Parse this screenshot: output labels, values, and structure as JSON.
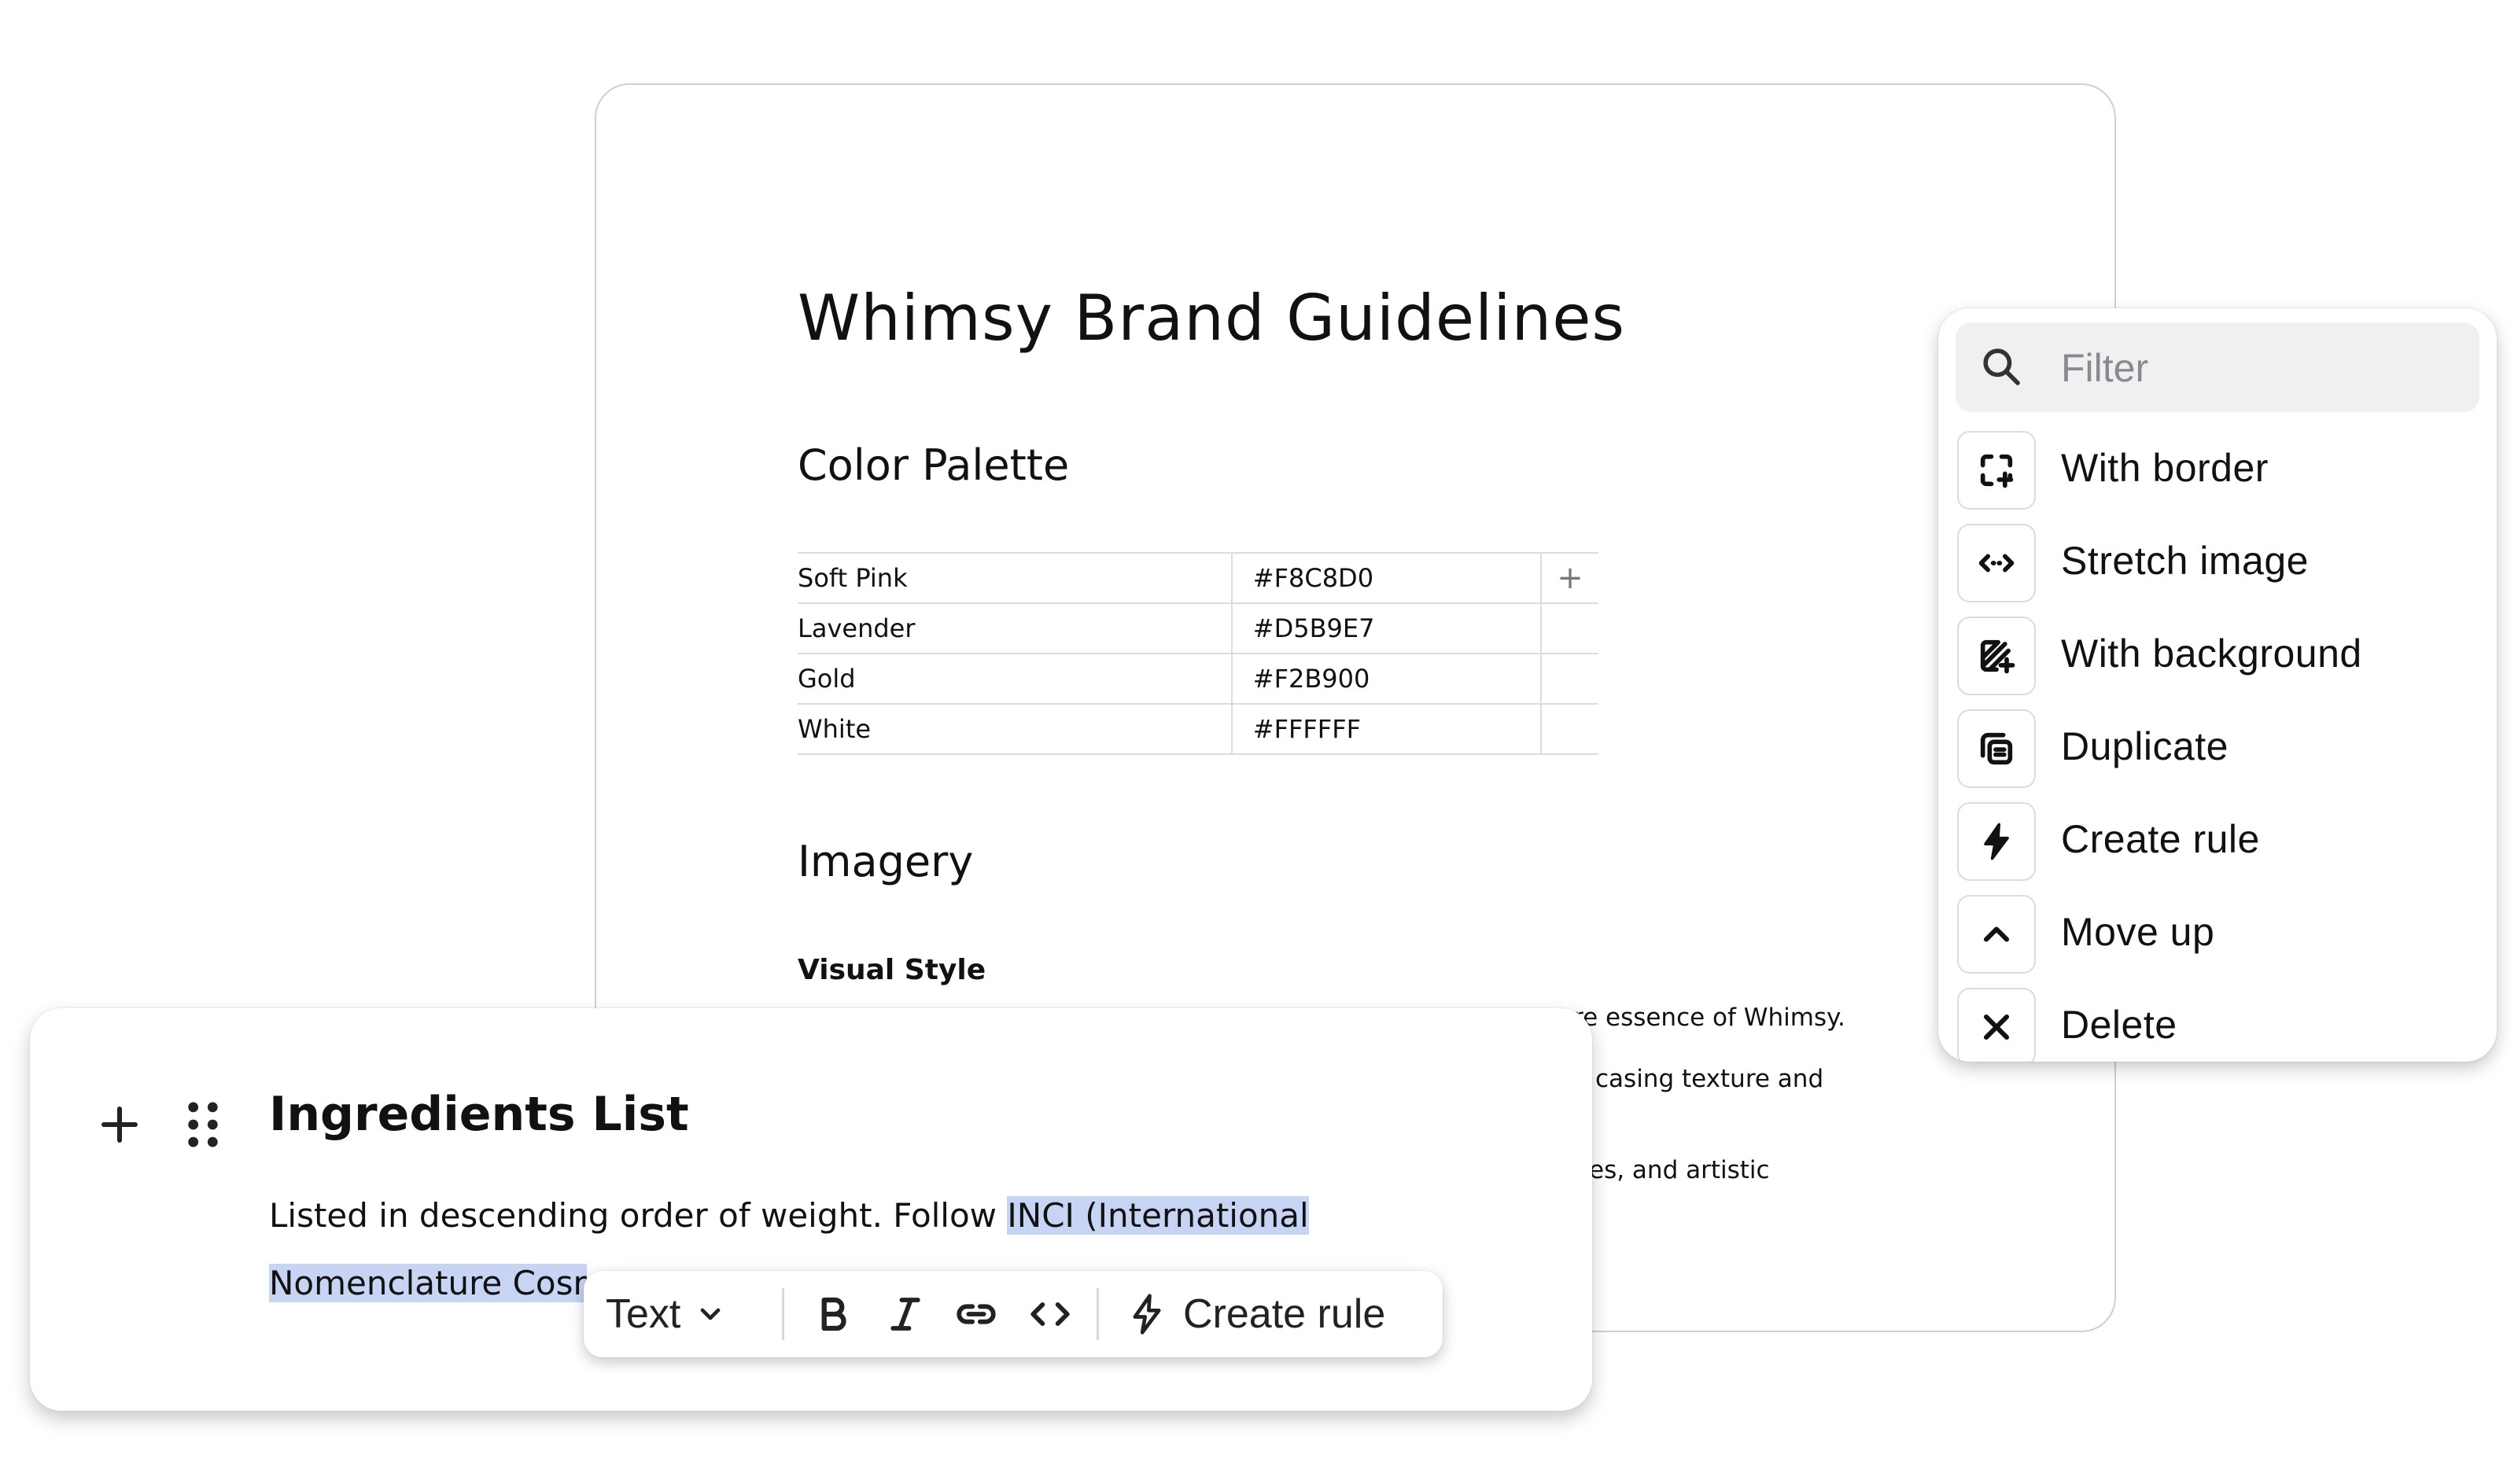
{
  "document": {
    "title": "Whimsy Brand Guidelines",
    "section_color_palette": "Color Palette",
    "palette": [
      {
        "name": "Soft Pink",
        "hex": "#F8C8D0"
      },
      {
        "name": "Lavender",
        "hex": "#D5B9E7"
      },
      {
        "name": "Gold",
        "hex": "#F2B900"
      },
      {
        "name": "White",
        "hex": "#FFFFFF"
      }
    ],
    "add_column_symbol": "+",
    "section_imagery": "Imagery",
    "visual_style_heading": "Visual Style",
    "fragments": [
      "re essence of Whimsy.",
      "casing texture and",
      "es, and artistic"
    ]
  },
  "filter_menu": {
    "placeholder": "Filter",
    "items": [
      {
        "label": "With border",
        "icon": "frame-plus-icon"
      },
      {
        "label": "Stretch image",
        "icon": "stretch-arrows-icon"
      },
      {
        "label": "With background",
        "icon": "background-edit-icon"
      },
      {
        "label": "Duplicate",
        "icon": "copy-icon"
      },
      {
        "label": "Create rule",
        "icon": "bolt-icon"
      },
      {
        "label": "Move up",
        "icon": "chevron-up-icon"
      },
      {
        "label": "Delete",
        "icon": "close-icon"
      }
    ]
  },
  "editor": {
    "heading": "Ingredients List",
    "para_line1_plain": "Listed in descending order of weight. Follow ",
    "para_line1_highlight": "INCI (International ",
    "para_line2_highlight": "Nomenclature Cosr"
  },
  "toolbar": {
    "text_style_label": "Text",
    "create_rule_label": "Create rule"
  },
  "colors": {
    "highlight": "#C8D4F4",
    "filter_bg": "#F0F0F1",
    "border": "#DCDCDC"
  }
}
